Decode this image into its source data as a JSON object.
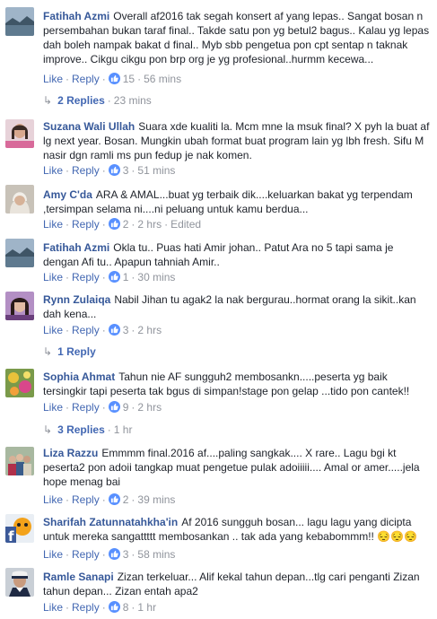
{
  "colors": {
    "link": "#4267b2",
    "author": "#365899",
    "meta": "#90949c",
    "like_badge": "#5890ff"
  },
  "comments": [
    {
      "author": "Fatihah Azmi",
      "avatar": "landscape-photo",
      "text": "Overall af2016 tak segah konsert af yang lepas.. Sangat bosan n persembahan bukan taraf final.. Takde satu pon yg betul2 bagus.. Kalau yg lepas dah boleh nampak bakat d final.. Myb sbb pengetua pon cpt sentap n taknak improve.. Cikgu cikgu pon brp org je yg profesional..hurmm kecewa...",
      "like": "Like",
      "reply": "Reply",
      "likes": "15",
      "time": "56 mins",
      "replies": "2 Replies",
      "replies_time": "23 mins"
    },
    {
      "author": "Suzana Wali Ullah",
      "avatar": "woman-photo",
      "text": "Suara xde kualiti la. Mcm mne la msuk final? X pyh la buat af lg next year. Bosan. Mungkin ubah format buat program lain yg lbh fresh. Sifu M nasir dgn ramli ms pun fedup je nak komen.",
      "like": "Like",
      "reply": "Reply",
      "likes": "3",
      "time": "51 mins"
    },
    {
      "author": "Amy C'da",
      "avatar": "hijab-photo",
      "text": "ARA & AMAL...buat yg terbaik dik....keluarkan bakat yg terpendam ,tersimpan selama ni....ni peluang untuk kamu berdua...",
      "like": "Like",
      "reply": "Reply",
      "likes": "2",
      "time": "2 hrs",
      "edited": "Edited"
    },
    {
      "author": "Fatihah Azmi",
      "avatar": "landscape-photo",
      "text": "Okla tu.. Puas hati Amir johan.. Patut Ara no 5 tapi sama je dengan Afi tu.. Apapun tahniah Amir..",
      "like": "Like",
      "reply": "Reply",
      "likes": "1",
      "time": "30 mins"
    },
    {
      "author": "Rynn Zulaiqa",
      "avatar": "woman-photo-2",
      "text": "Nabil Jihan tu agak2 la nak bergurau..hormat orang la sikit..kan dah kena...",
      "like": "Like",
      "reply": "Reply",
      "likes": "3",
      "time": "2 hrs",
      "replies": "1 Reply"
    },
    {
      "author": "Sophia Ahmat",
      "avatar": "flowers-photo",
      "text": "Tahun nie AF sungguh2 membosankn.....peserta yg baik tersingkir tapi peserta tak bgus di simpan!stage pon gelap ...tido pon cantek!!",
      "like": "Like",
      "reply": "Reply",
      "likes": "9",
      "time": "2 hrs",
      "replies": "3 Replies",
      "replies_time": "1 hr"
    },
    {
      "author": "Liza Razzu",
      "avatar": "group-photo",
      "text": "Emmmm final.2016 af....paling sangkak.... X rare.. Lagu bgi kt peserta2 pon adoii tangkap muat pengetue pulak adoiiiii.... Amal or amer.....jela hope menag bai",
      "like": "Like",
      "reply": "Reply",
      "likes": "2",
      "time": "39 mins"
    },
    {
      "author": "Sharifah Zatunnatahkha'in",
      "avatar": "cartoon-photo",
      "text": "Af 2016 sungguh bosan... lagu lagu yang dicipta untuk mereka sangattttt membosankan .. tak ada yang kebabommm!! 😔😔😔",
      "like": "Like",
      "reply": "Reply",
      "likes": "3",
      "time": "58 mins"
    },
    {
      "author": "Ramle Sanapi",
      "avatar": "man-photo",
      "text": "Zizan terkeluar... Alif kekal tahun depan...tlg cari penganti Zizan tahun depan... Zizan entah apa2",
      "like": "Like",
      "reply": "Reply",
      "likes": "8",
      "time": "1 hr"
    }
  ]
}
